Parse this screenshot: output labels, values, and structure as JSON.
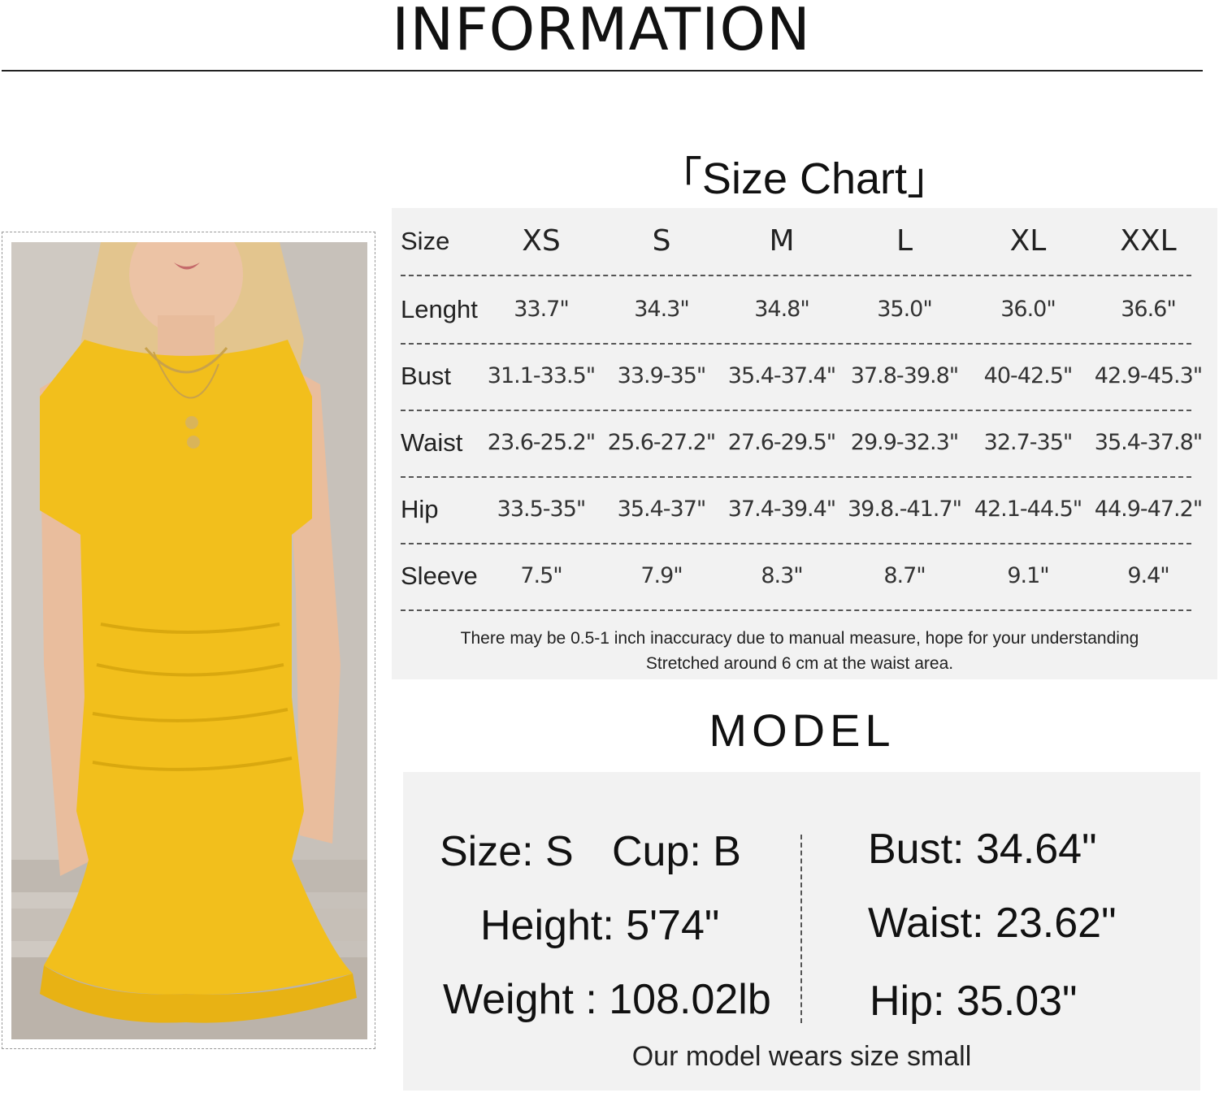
{
  "header": {
    "title": "INFORMATION"
  },
  "size_chart": {
    "title": "「Size Chart」",
    "header_label": "Size",
    "sizes": [
      "XS",
      "S",
      "M",
      "L",
      "XL",
      "XXL"
    ],
    "rows": [
      {
        "label": "Lenght",
        "values": [
          "33.7\"",
          "34.3\"",
          "34.8\"",
          "35.0\"",
          "36.0\"",
          "36.6\""
        ]
      },
      {
        "label": "Bust",
        "values": [
          "31.1-33.5\"",
          "33.9-35\"",
          "35.4-37.4\"",
          "37.8-39.8\"",
          "40-42.5\"",
          "42.9-45.3\""
        ]
      },
      {
        "label": "Waist",
        "values": [
          "23.6-25.2\"",
          "25.6-27.2\"",
          "27.6-29.5\"",
          "29.9-32.3\"",
          "32.7-35\"",
          "35.4-37.8\""
        ]
      },
      {
        "label": "Hip",
        "values": [
          "33.5-35\"",
          "35.4-37\"",
          "37.4-39.4\"",
          "39.8.-41.7\"",
          "42.1-44.5\"",
          "44.9-47.2\""
        ]
      },
      {
        "label": "Sleeve",
        "values": [
          "7.5\"",
          "7.9\"",
          "8.3\"",
          "8.7\"",
          "9.1\"",
          "9.4\""
        ]
      }
    ],
    "notes": [
      "There may be 0.5-1 inch inaccuracy due to manual measure, hope for your understanding",
      "Stretched around 6 cm at the waist area."
    ]
  },
  "model": {
    "title": "MODEL",
    "size": "Size: S",
    "cup": "Cup: B",
    "height": "Height: 5'74\"",
    "weight": "Weight : 108.02lb",
    "bust": "Bust: 34.64\"",
    "waist": "Waist: 23.62\"",
    "hip": "Hip: 35.03\"",
    "caption": "Our model wears size small"
  },
  "colors": {
    "dress": "#f2bf1c",
    "panel": "#f2f2f2"
  }
}
